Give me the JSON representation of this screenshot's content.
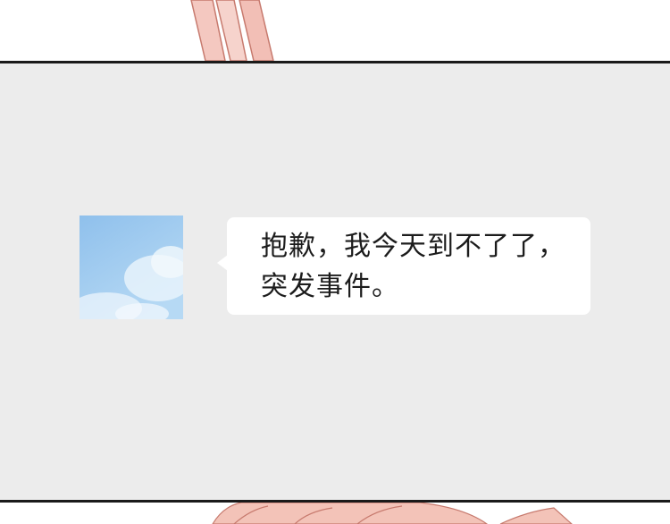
{
  "chat": {
    "message": "抱歉，我今天到不了了，\n突发事件。"
  },
  "colors": {
    "panel_background": "#ececec",
    "bubble_background": "#ffffff",
    "sky_blue": "#9fcbef",
    "art_pink": "#e8a59b"
  },
  "icons": {
    "avatar": "sky-clouds-avatar-icon"
  }
}
